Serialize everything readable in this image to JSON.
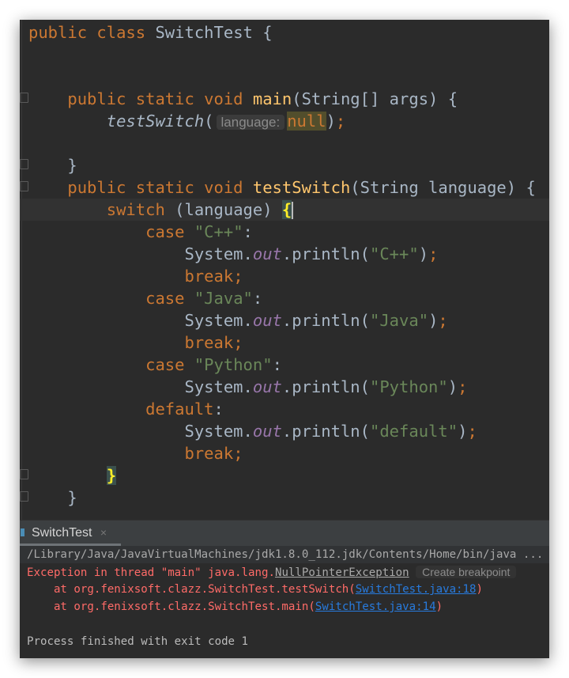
{
  "editor": {
    "lines": [
      [
        [
          "public class ",
          "kw"
        ],
        [
          "SwitchTest {",
          ""
        ]
      ],
      [],
      [],
      [
        [
          "    public static void ",
          "kw"
        ],
        [
          "main",
          "fn"
        ],
        [
          "(String[] args) {",
          ""
        ]
      ],
      [
        [
          "        ",
          ""
        ],
        [
          "testSwitch",
          "it"
        ],
        [
          "(",
          ""
        ],
        [
          "language:",
          "hint"
        ],
        [
          "null",
          "kw nullhl"
        ],
        [
          ")",
          ""
        ],
        [
          ";",
          "kw"
        ]
      ],
      [],
      [
        [
          "    }",
          ""
        ]
      ],
      [
        [
          "    public static void ",
          "kw"
        ],
        [
          "testSwitch",
          "fn"
        ],
        [
          "(String language) {",
          ""
        ]
      ],
      [
        [
          "        ",
          ""
        ],
        [
          "switch",
          "kw"
        ],
        [
          " (language) ",
          ""
        ],
        [
          "{",
          "brace"
        ],
        [
          "|",
          "caret"
        ]
      ],
      [
        [
          "            ",
          ""
        ],
        [
          "case ",
          "kw"
        ],
        [
          "\"C++\"",
          "str"
        ],
        [
          ":",
          ""
        ]
      ],
      [
        [
          "                System.",
          ""
        ],
        [
          "out",
          "fld"
        ],
        [
          ".println(",
          ""
        ],
        [
          "\"C++\"",
          "str"
        ],
        [
          ")",
          ""
        ],
        [
          ";",
          "kw"
        ]
      ],
      [
        [
          "                ",
          ""
        ],
        [
          "break;",
          "kw"
        ]
      ],
      [
        [
          "            ",
          ""
        ],
        [
          "case ",
          "kw"
        ],
        [
          "\"Java\"",
          "str"
        ],
        [
          ":",
          ""
        ]
      ],
      [
        [
          "                System.",
          ""
        ],
        [
          "out",
          "fld"
        ],
        [
          ".println(",
          ""
        ],
        [
          "\"Java\"",
          "str"
        ],
        [
          ")",
          ""
        ],
        [
          ";",
          "kw"
        ]
      ],
      [
        [
          "                ",
          ""
        ],
        [
          "break;",
          "kw"
        ]
      ],
      [
        [
          "            ",
          ""
        ],
        [
          "case ",
          "kw"
        ],
        [
          "\"Python\"",
          "str"
        ],
        [
          ":",
          ""
        ]
      ],
      [
        [
          "                System.",
          ""
        ],
        [
          "out",
          "fld"
        ],
        [
          ".println(",
          ""
        ],
        [
          "\"Python\"",
          "str"
        ],
        [
          ")",
          ""
        ],
        [
          ";",
          "kw"
        ]
      ],
      [
        [
          "            ",
          ""
        ],
        [
          "default",
          "kw"
        ],
        [
          ":",
          ""
        ]
      ],
      [
        [
          "                System.",
          ""
        ],
        [
          "out",
          "fld"
        ],
        [
          ".println(",
          ""
        ],
        [
          "\"default\"",
          "str"
        ],
        [
          ")",
          ""
        ],
        [
          ";",
          "kw"
        ]
      ],
      [
        [
          "                ",
          ""
        ],
        [
          "break;",
          "kw"
        ]
      ],
      [
        [
          "        ",
          ""
        ],
        [
          "}",
          "brace"
        ]
      ],
      [
        [
          "    }",
          ""
        ]
      ]
    ]
  },
  "run_tab": {
    "label": "SwitchTest",
    "close": "×"
  },
  "console": {
    "command": "/Library/Java/JavaVirtualMachines/jdk1.8.0_112.jdk/Contents/Home/bin/java ...",
    "exception_prefix": "Exception in thread \"main\" java.lang.",
    "exception_class": "NullPointerException",
    "create_breakpoint": "Create breakpoint",
    "trace": [
      {
        "prefix": "    at org.fenixsoft.clazz.SwitchTest.testSwitch(",
        "link": "SwitchTest.java:18",
        "suffix": ")"
      },
      {
        "prefix": "    at org.fenixsoft.clazz.SwitchTest.main(",
        "link": "SwitchTest.java:14",
        "suffix": ")"
      }
    ],
    "exit": "Process finished with exit code 1"
  }
}
